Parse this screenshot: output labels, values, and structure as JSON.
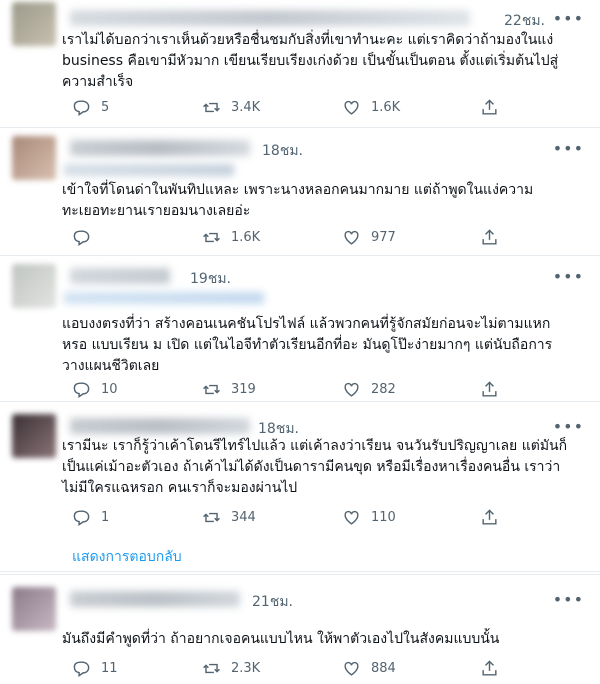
{
  "tweets": [
    {
      "time": "22ชม.",
      "lines": [
        "เราไม่ได้บอกว่าเราเห็นด้วยหรือชื่นชมกับสิ่งที่เขาทำนะคะ แต่เราคิดว่าถ้ามองในแง่",
        "business คือเขามีหัวมาก เขียนเรียบเรียงเก่งด้วย เป็นขั้นเป็นตอน ตั้งแต่เริ่มต้นไปสู่",
        "ความสำเร็จ"
      ],
      "replies": "5",
      "retweets": "3.4K",
      "likes": "1.6K"
    },
    {
      "time": "18ชม.",
      "lines": [
        "เข้าใจที่โดนด่าในพันทิปแหละ เพราะนางหลอกคนมากมาย แต่ถ้าพูดในแง่ความ",
        "ทะเยอทะยานเรายอมนางเลยอ่ะ"
      ],
      "replies": "",
      "retweets": "1.6K",
      "likes": "977"
    },
    {
      "time": "19ชม.",
      "lines": [
        "แอบงงตรงที่ว่า สร้างคอนเนคชันโปรไฟล์ แล้วพวกคนที่รู้จักสมัยก่อนจะไม่ตามแหก",
        "หรอ แบบเรียน ม เปิด แต่ในไอจีทำตัวเรียนอีกที่อะ มันดูโป๊ะง่ายมากๆ แต่นับถือการ",
        "วางแผนชีวิตเลย"
      ],
      "replies": "10",
      "retweets": "319",
      "likes": "282"
    },
    {
      "time": "18ชม.",
      "lines": [
        "เรามีนะ เราก็รู้ว่าเค้าโดนรีไทร์ไปแล้ว แต่เค้าลงว่าเรียน จนวันรับปริญญาเลย แต่มันก็",
        "เป็นแค่เม้าอะตัวเอง ถ้าเค้าไม่ได้ดังเป็นดารามีคนขุด หรือมีเรื่องหาเรื่องคนอื่น เราว่า",
        "ไม่มีใครแฉหรอก คนเราก็จะมองผ่านไป"
      ],
      "replies": "1",
      "retweets": "344",
      "likes": "110"
    },
    {
      "time": "21ชม.",
      "lines": [
        "มันถึงมีคำพูดที่ว่า ถ้าอยากเจอคนแบบไหน ให้พาตัวเองไปในสังคมแบบนั้น"
      ],
      "replies": "11",
      "retweets": "2.3K",
      "likes": "884"
    }
  ],
  "show_replies_label": "แสดงการตอบกลับ",
  "more_label": "•••",
  "icons": [
    "reply-icon",
    "retweet-icon",
    "like-icon",
    "share-icon"
  ],
  "colors": {
    "text": "#0f1419",
    "muted": "#536471",
    "link": "#1d9bf0",
    "divider": "#e6ecf0"
  }
}
